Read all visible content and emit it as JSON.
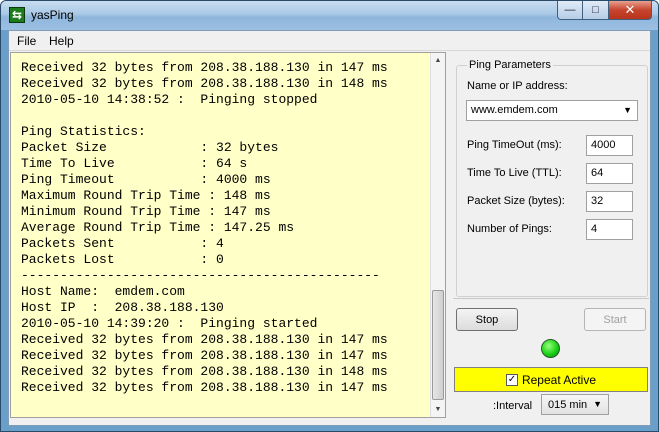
{
  "window": {
    "title": "yasPing",
    "app_icon": "swap-arrows-icon"
  },
  "window_controls": {
    "minimize": "—",
    "maximize": "□",
    "close": "✕"
  },
  "menu": [
    {
      "label": "File"
    },
    {
      "label": "Help"
    }
  ],
  "log": {
    "lines": [
      "Received 32 bytes from 208.38.188.130 in 147 ms",
      "Received 32 bytes from 208.38.188.130 in 148 ms",
      "2010-05-10 14:38:52 :  Pinging stopped",
      "",
      "Ping Statistics:",
      "Packet Size            : 32 bytes",
      "Time To Live           : 64 s",
      "Ping Timeout           : 4000 ms",
      "Maximum Round Trip Time : 148 ms",
      "Minimum Round Trip Time : 147 ms",
      "Average Round Trip Time : 147.25 ms",
      "Packets Sent           : 4",
      "Packets Lost           : 0",
      "----------------------------------------------",
      "Host Name:  emdem.com",
      "Host IP  :  208.38.188.130",
      "2010-05-10 14:39:20 :  Pinging started",
      "Received 32 bytes from 208.38.188.130 in 147 ms",
      "Received 32 bytes from 208.38.188.130 in 147 ms",
      "Received 32 bytes from 208.38.188.130 in 148 ms",
      "Received 32 bytes from 208.38.188.130 in 147 ms"
    ]
  },
  "params": {
    "group_title": "Ping Parameters",
    "host_label": "Name or IP address:",
    "host_value": "www.emdem.com",
    "timeout_label": "Ping TimeOut (ms):",
    "timeout_value": "4000",
    "ttl_label": "Time To Live (TTL):",
    "ttl_value": "64",
    "packet_size_label": "Packet Size (bytes):",
    "packet_size_value": "32",
    "num_pings_label": "Number of Pings:",
    "num_pings_value": "4"
  },
  "controls": {
    "stop_label": "Stop",
    "start_label": "Start",
    "status_led_color": "#19d119",
    "repeat_label": "Repeat Active",
    "repeat_checked": true,
    "repeat_bg": "#ffff00",
    "interval_label": ":Interval",
    "interval_value": "015 min"
  }
}
